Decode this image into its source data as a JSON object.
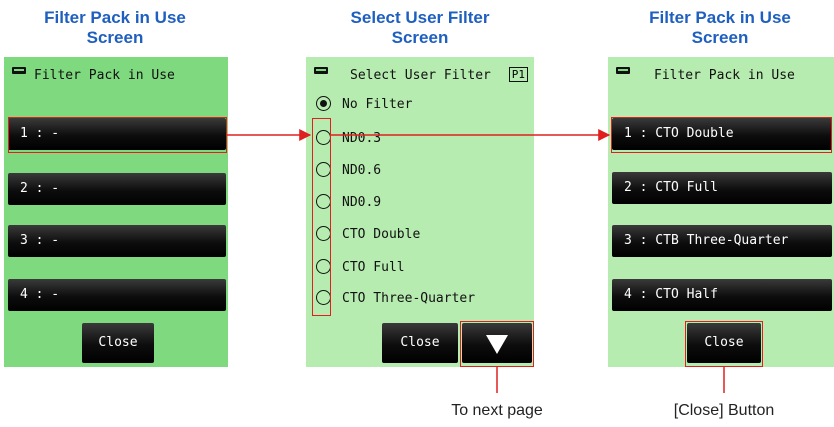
{
  "headings": {
    "left": [
      "Filter Pack in Use",
      "Screen"
    ],
    "middle": [
      "Select User Filter",
      "Screen"
    ],
    "right": [
      "Filter Pack in Use",
      "Screen"
    ]
  },
  "screen_left": {
    "title": "Filter Pack in Use",
    "slots": [
      "1 : -",
      "2 : -",
      "3 : -",
      "4 : -"
    ],
    "close_label": "Close"
  },
  "screen_middle": {
    "title": "Select User Filter",
    "page_badge": "P1",
    "options": [
      {
        "label": "No Filter",
        "selected": true
      },
      {
        "label": "ND0.3",
        "selected": false
      },
      {
        "label": "ND0.6",
        "selected": false
      },
      {
        "label": "ND0.9",
        "selected": false
      },
      {
        "label": "CTO Double",
        "selected": false
      },
      {
        "label": "CTO Full",
        "selected": false
      },
      {
        "label": "CTO Three-Quarter",
        "selected": false
      }
    ],
    "close_label": "Close",
    "next_icon": "triangle-down-icon"
  },
  "screen_right": {
    "title": "Filter Pack in Use",
    "slots": [
      "1 : CTO Double",
      "2 : CTO Full",
      "3 : CTB Three-Quarter",
      "4 : CTO Half"
    ],
    "close_label": "Close"
  },
  "captions": {
    "next_page": "To next page",
    "close_button": "[Close] Button"
  },
  "colors": {
    "heading": "#1f5fbf",
    "highlight": "#e02020",
    "screen_green_dark": "#7fd97f",
    "screen_green_light": "#b6ecb0"
  }
}
